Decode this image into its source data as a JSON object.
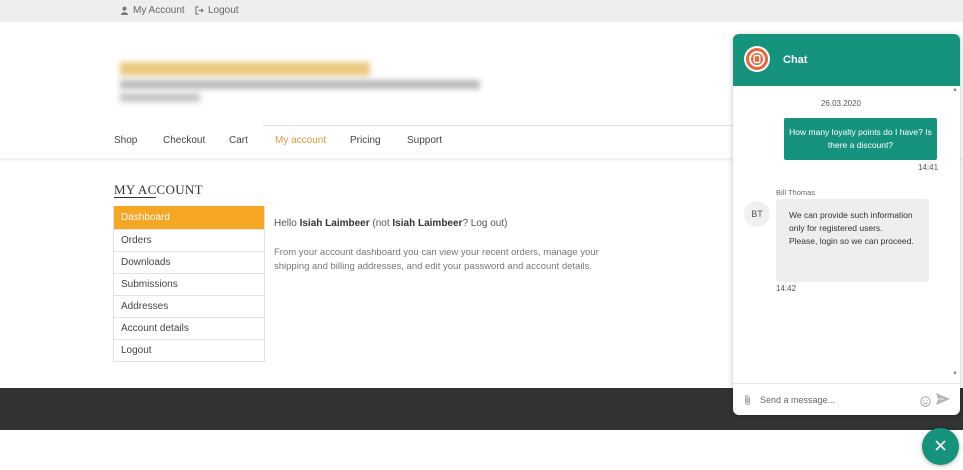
{
  "topbar": {
    "my_account": "My Account",
    "logout": "Logout"
  },
  "nav": {
    "items": [
      "Shop",
      "Checkout",
      "Cart",
      "My account",
      "Pricing",
      "Support"
    ],
    "active": "My account"
  },
  "account": {
    "title": "MY ACCOUNT",
    "menu": [
      "Dashboard",
      "Orders",
      "Downloads",
      "Submissions",
      "Addresses",
      "Account details",
      "Logout"
    ],
    "active_menu": "Dashboard",
    "hello_prefix": "Hello ",
    "user_name": "Isiah Laimbeer",
    "not_prefix": " (not ",
    "not_suffix": "? Log out)",
    "description": "From your account dashboard you can view your recent orders, manage your shipping and billing addresses, and edit your password and account details."
  },
  "chat": {
    "title": "Chat",
    "date": "26.03.2020",
    "outgoing": {
      "text": "How many loyalty points do I have? Is there a discount?",
      "time": "14:41"
    },
    "incoming": {
      "sender": "Bill Thomas",
      "avatar": "BT",
      "lines": [
        "We can provide such information only for registered users.",
        "Please, login so we can proceed."
      ],
      "time": "14:42"
    },
    "input_placeholder": "Send a message..."
  },
  "colors": {
    "accent": "#16937c",
    "active_menu": "#f5a623",
    "active_nav": "#e3983b",
    "footer": "#333333"
  },
  "icons": [
    "user-icon",
    "logout-icon",
    "chat-logo-icon",
    "attach-icon",
    "emoji-icon",
    "send-icon",
    "close-icon"
  ]
}
